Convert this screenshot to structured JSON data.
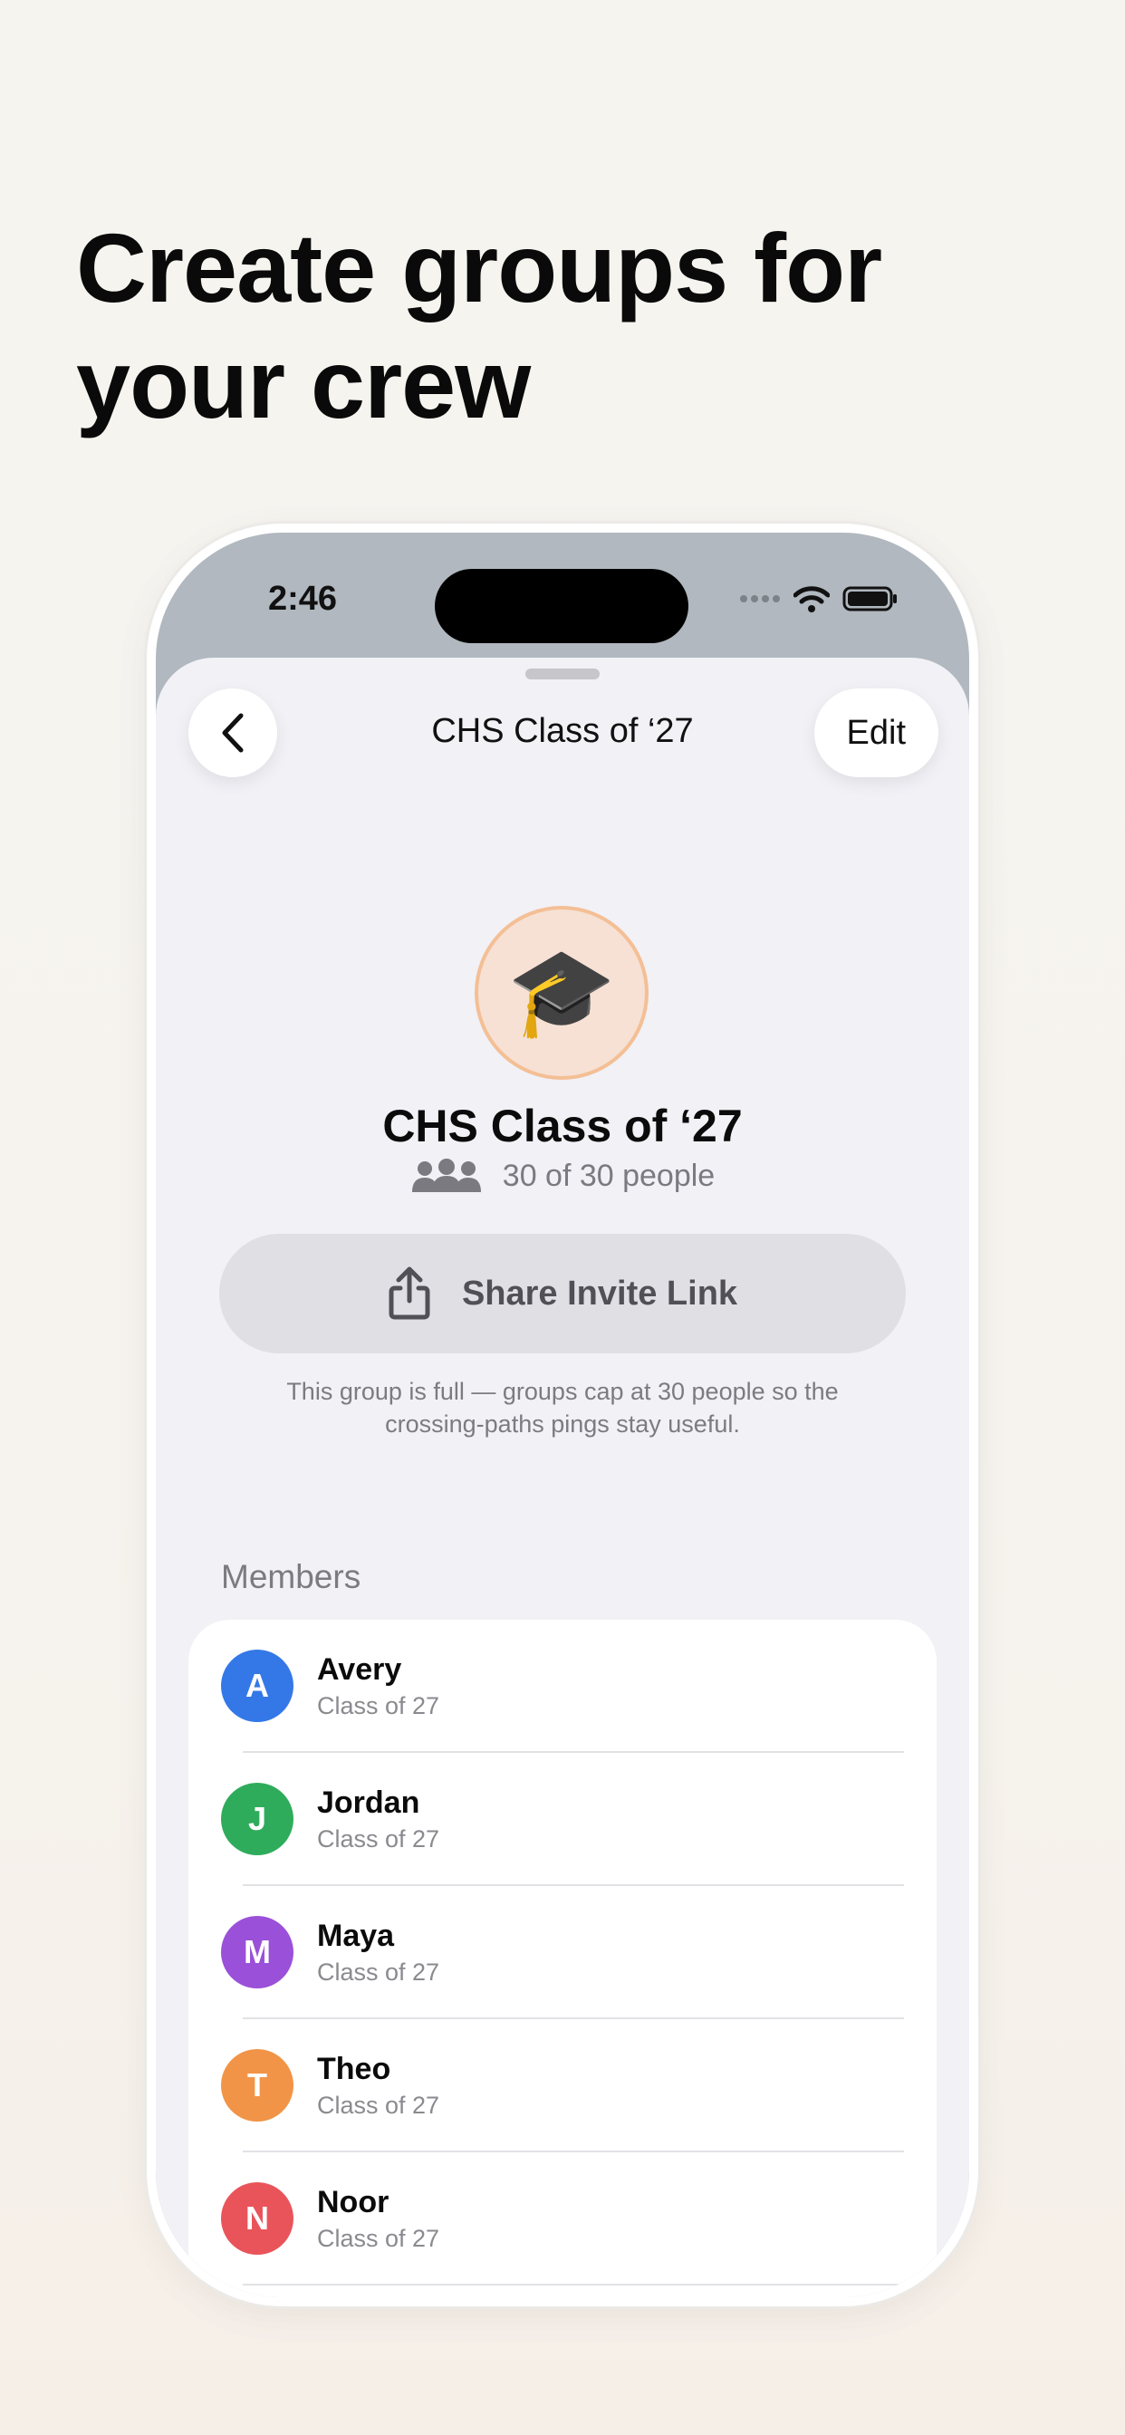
{
  "headline": "Create groups for your crew",
  "status": {
    "time": "2:46"
  },
  "nav": {
    "title": "CHS Class of ‘27",
    "edit_label": "Edit"
  },
  "group": {
    "emoji": "🎓",
    "name": "CHS Class of ‘27",
    "count": "30 of 30 people",
    "share_label": "Share Invite Link",
    "full_note": "This group is full — groups cap at 30 people so the crossing-paths pings stay useful."
  },
  "members": {
    "label": "Members",
    "items": [
      {
        "initial": "A",
        "name": "Avery",
        "subtitle": "Class of 27",
        "color": "#3478e8"
      },
      {
        "initial": "J",
        "name": "Jordan",
        "subtitle": "Class of 27",
        "color": "#2fac5b"
      },
      {
        "initial": "M",
        "name": "Maya",
        "subtitle": "Class of 27",
        "color": "#9a50d8"
      },
      {
        "initial": "T",
        "name": "Theo",
        "subtitle": "Class of 27",
        "color": "#f19447"
      },
      {
        "initial": "N",
        "name": "Noor",
        "subtitle": "Class of 27",
        "color": "#e9545a"
      }
    ]
  }
}
